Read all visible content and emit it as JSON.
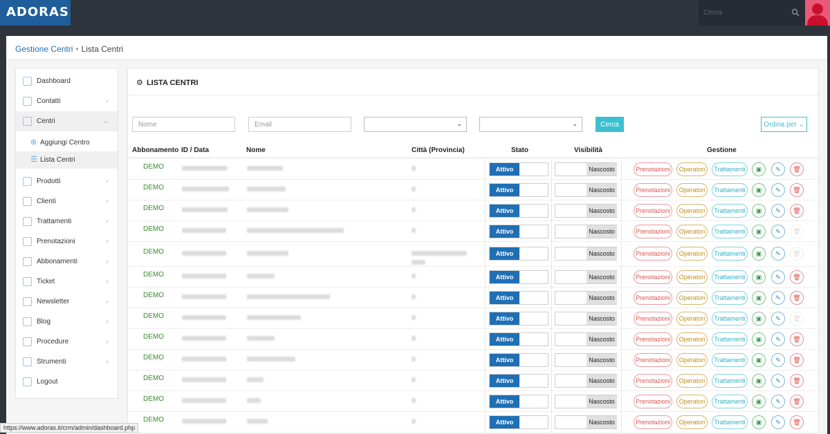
{
  "brand": {
    "logo": "ADORAS"
  },
  "topbar": {
    "search_placeholder": "Cerca"
  },
  "breadcrumb": {
    "parent": "Gestione Centri",
    "separator": "•",
    "current": "Lista Centri"
  },
  "sidebar": {
    "items": [
      {
        "label": "Dashboard",
        "icon": "dashboard-icon",
        "chevron": ""
      },
      {
        "label": "Contatti",
        "icon": "home-icon",
        "chevron": "‹"
      },
      {
        "label": "Centri",
        "icon": "location-icon",
        "chevron": "⌄",
        "active": true
      },
      {
        "label": "Prodotti",
        "icon": "tag-icon",
        "chevron": "‹"
      },
      {
        "label": "Clienti",
        "icon": "users-icon",
        "chevron": "‹"
      },
      {
        "label": "Trattamenti",
        "icon": "drop-icon",
        "chevron": "‹"
      },
      {
        "label": "Prenotazioni",
        "icon": "calendar-icon",
        "chevron": "‹"
      },
      {
        "label": "Abbonamenti",
        "icon": "document-icon",
        "chevron": "‹"
      },
      {
        "label": "Ticket",
        "icon": "send-icon",
        "chevron": "‹"
      },
      {
        "label": "Newsletter",
        "icon": "mail-icon",
        "chevron": "‹"
      },
      {
        "label": "Blog",
        "icon": "edit-icon",
        "chevron": "‹"
      },
      {
        "label": "Procedure",
        "icon": "lightbulb-icon",
        "chevron": "‹"
      },
      {
        "label": "Strumenti",
        "icon": "wrench-icon",
        "chevron": "‹"
      },
      {
        "label": "Logout",
        "icon": "key-icon",
        "chevron": ""
      }
    ],
    "subitems": [
      {
        "label": "Aggiungi Centro",
        "icon": "plus-circle-icon"
      },
      {
        "label": "Lista Centri",
        "icon": "list-icon"
      }
    ]
  },
  "panel": {
    "title": "LISTA CENTRI"
  },
  "filters": {
    "nome_placeholder": "Nome",
    "email_placeholder": "Email",
    "cerca_label": "Cerca",
    "ordina_label": "Ordina per ⌄"
  },
  "table": {
    "headers": {
      "abbonamento": "Abbonamento",
      "id_data": "ID / Data",
      "nome": "Nome",
      "citta": "Città (Provincia)",
      "stato": "Stato",
      "visibilita": "Visibilità",
      "gestione": "Gestione"
    },
    "toggle_on": "Attivo",
    "toggle_off": "Nascosto",
    "btn_prenotazioni": "Prenotazioni",
    "btn_operatori": "Operatori",
    "btn_trattamenti": "Trattamenti",
    "rows": [
      {
        "abbonamento": "DEMO",
        "delete": true
      },
      {
        "abbonamento": "DEMO",
        "delete": true
      },
      {
        "abbonamento": "DEMO",
        "delete": true
      },
      {
        "abbonamento": "DEMO",
        "delete": false
      },
      {
        "abbonamento": "DEMO",
        "delete": false,
        "tall": true
      },
      {
        "abbonamento": "DEMO",
        "delete": true
      },
      {
        "abbonamento": "DEMO",
        "delete": true
      },
      {
        "abbonamento": "DEMO",
        "delete": false
      },
      {
        "abbonamento": "DEMO",
        "delete": true
      },
      {
        "abbonamento": "DEMO",
        "delete": true
      },
      {
        "abbonamento": "DEMO",
        "delete": true
      },
      {
        "abbonamento": "DEMO",
        "delete": true
      },
      {
        "abbonamento": "DEMO",
        "delete": true
      }
    ]
  },
  "status_url": "https://www.adoras.it/crm/admin/dashboard.php"
}
